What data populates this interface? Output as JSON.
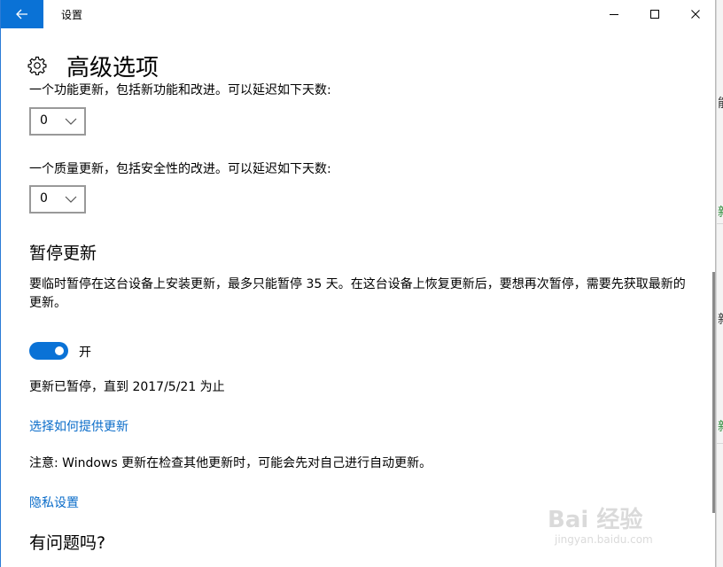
{
  "window": {
    "title": "设置"
  },
  "page": {
    "title": "高级选项",
    "feature_update_text": "一个功能更新，包括新功能和改进。可以延迟如下天数:",
    "feature_update_value": "0",
    "quality_update_text": "一个质量更新，包括安全性的改进。可以延迟如下天数:",
    "quality_update_value": "0"
  },
  "pause": {
    "title": "暂停更新",
    "description": "要临时暂停在这台设备上安装更新，最多只能暂停 35 天。在这台设备上恢复更新后，要想再次暂停，需要先获取最新的更新。",
    "toggle_label": "开",
    "toggle_on": true,
    "status": "更新已暂停，直到 2017/5/21 为止"
  },
  "links": {
    "delivery": "选择如何提供更新",
    "privacy": "隐私设置"
  },
  "note": "注意: Windows 更新在检查其他更新时，可能会先对自己进行自动更新。",
  "help_title": "有问题吗?",
  "watermark": {
    "line1": "Bai 经验",
    "line2": "jingyan.baidu.com"
  },
  "background_fragments": [
    "能",
    "新",
    "新",
    "新"
  ],
  "icons": {
    "back": "back-arrow-icon",
    "settings": "gear-icon",
    "minimize": "minimize-icon",
    "maximize": "maximize-icon",
    "close": "close-icon",
    "dropdown": "chevron-down-icon"
  },
  "colors": {
    "accent": "#0a72d6",
    "link": "#0a6cc9"
  }
}
